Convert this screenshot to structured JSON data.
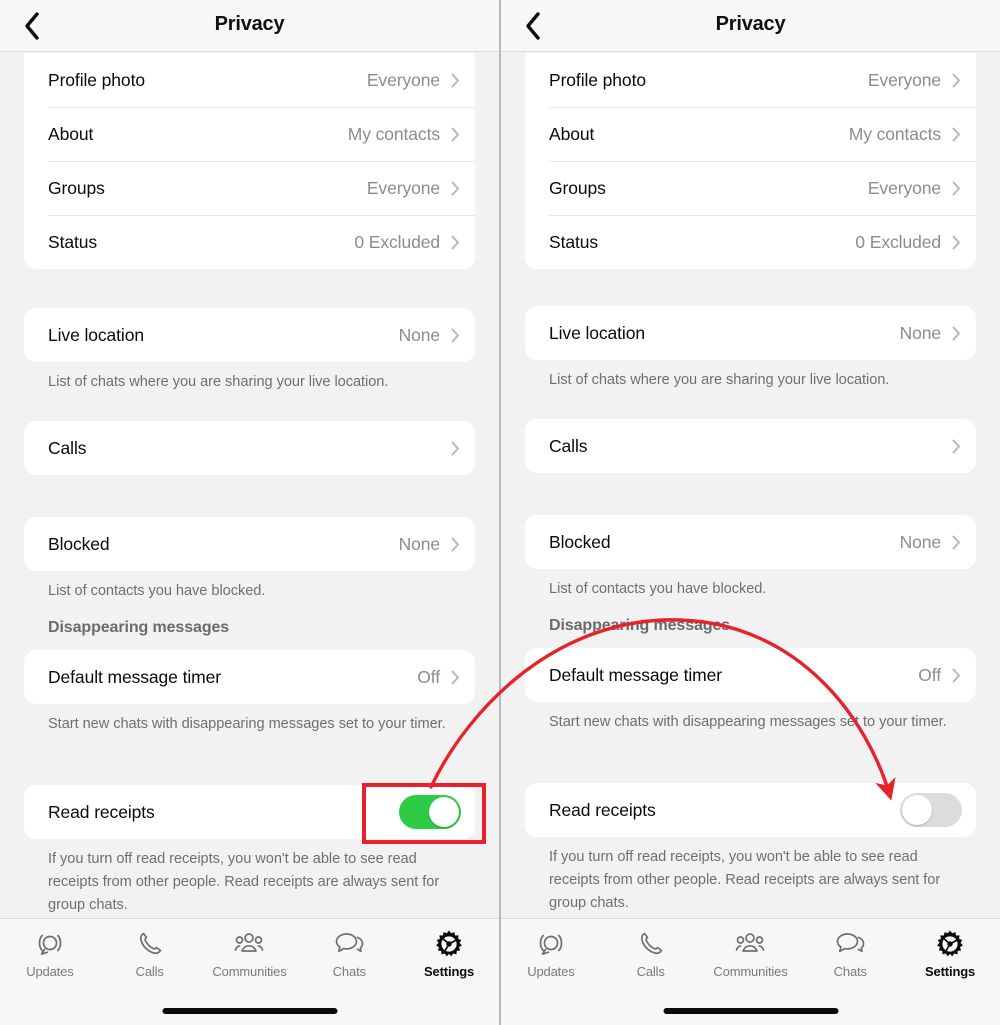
{
  "app": {
    "screen_title": "Privacy",
    "accent_green": "#2ECC45",
    "toggle_off_color": "#DCDCDE",
    "annotation_red": "#E8222A"
  },
  "header": {
    "title": "Privacy",
    "back_icon": "chevron-left-icon"
  },
  "sections": {
    "visibility": {
      "rows": [
        {
          "label": "Profile photo",
          "value": "Everyone"
        },
        {
          "label": "About",
          "value": "My contacts"
        },
        {
          "label": "Groups",
          "value": "Everyone"
        },
        {
          "label": "Status",
          "value": "0 Excluded"
        }
      ]
    },
    "live_location": {
      "rows": [
        {
          "label": "Live location",
          "value": "None"
        }
      ],
      "footnote": "List of chats where you are sharing your live location."
    },
    "calls": {
      "rows": [
        {
          "label": "Calls",
          "value": ""
        }
      ]
    },
    "blocked": {
      "rows": [
        {
          "label": "Blocked",
          "value": "None"
        }
      ],
      "footnote": "List of contacts you have blocked."
    },
    "disappearing": {
      "header": "Disappearing messages",
      "rows": [
        {
          "label": "Default message timer",
          "value": "Off"
        }
      ],
      "footnote": "Start new chats with disappearing messages set to your timer."
    },
    "read_receipts": {
      "label": "Read receipts",
      "footnote": "If you turn off read receipts, you won't be able to see read receipts from other people. Read receipts are always sent for group chats.",
      "state_before": "on",
      "state_after": "off"
    }
  },
  "tabbar": {
    "tabs": [
      {
        "label": "Updates",
        "icon": "updates-status-icon",
        "active": false
      },
      {
        "label": "Calls",
        "icon": "phone-icon",
        "active": false
      },
      {
        "label": "Communities",
        "icon": "communities-people-icon",
        "active": false
      },
      {
        "label": "Chats",
        "icon": "chat-bubbles-icon",
        "active": false
      },
      {
        "label": "Settings",
        "icon": "gear-icon",
        "active": true
      }
    ]
  },
  "annotations": {
    "highlight_target": "read-receipts-toggle-left",
    "arrow_from": "read-receipts-toggle-left",
    "arrow_to": "read-receipts-toggle-right"
  }
}
